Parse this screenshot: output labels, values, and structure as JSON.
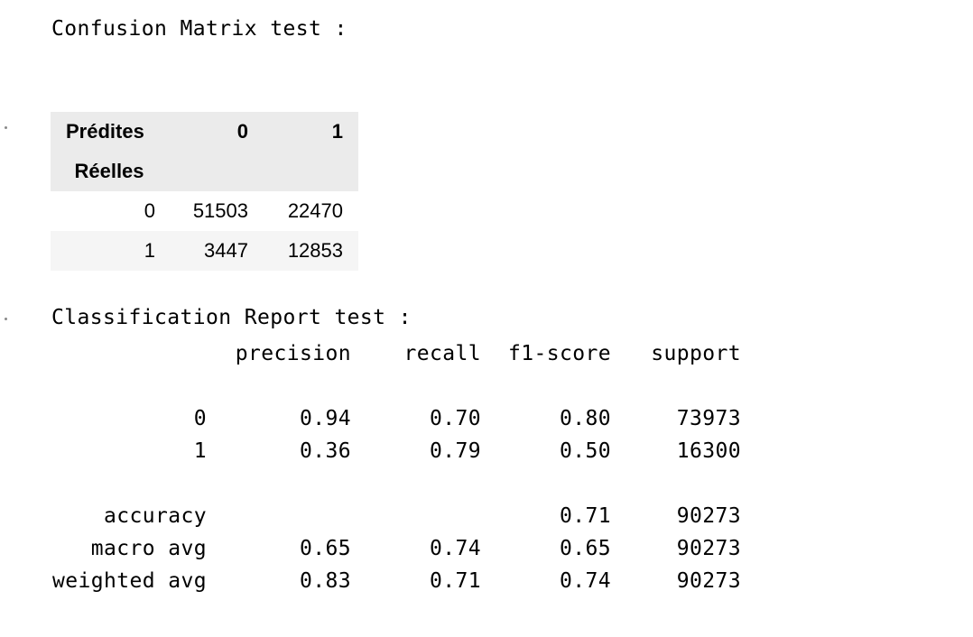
{
  "confusion_matrix": {
    "title": "Confusion Matrix test :",
    "columns_name": "Prédites",
    "index_name": "Réelles",
    "columns": [
      "0",
      "1"
    ],
    "rows": [
      {
        "index": "0",
        "values": [
          "51503",
          "22470"
        ]
      },
      {
        "index": "1",
        "values": [
          "3447",
          "12853"
        ]
      }
    ]
  },
  "classification_report": {
    "title": "Classification Report test :",
    "headers": [
      "precision",
      "recall",
      "f1-score",
      "support"
    ],
    "class_rows": [
      {
        "label": "0",
        "precision": "0.94",
        "recall": "0.70",
        "f1": "0.80",
        "support": "73973"
      },
      {
        "label": "1",
        "precision": "0.36",
        "recall": "0.79",
        "f1": "0.50",
        "support": "16300"
      }
    ],
    "summary_rows": [
      {
        "label": "accuracy",
        "precision": "",
        "recall": "",
        "f1": "0.71",
        "support": "90273"
      },
      {
        "label": "macro avg",
        "precision": "0.65",
        "recall": "0.74",
        "f1": "0.65",
        "support": "90273"
      },
      {
        "label": "weighted avg",
        "precision": "0.83",
        "recall": "0.71",
        "f1": "0.74",
        "support": "90273"
      }
    ]
  }
}
